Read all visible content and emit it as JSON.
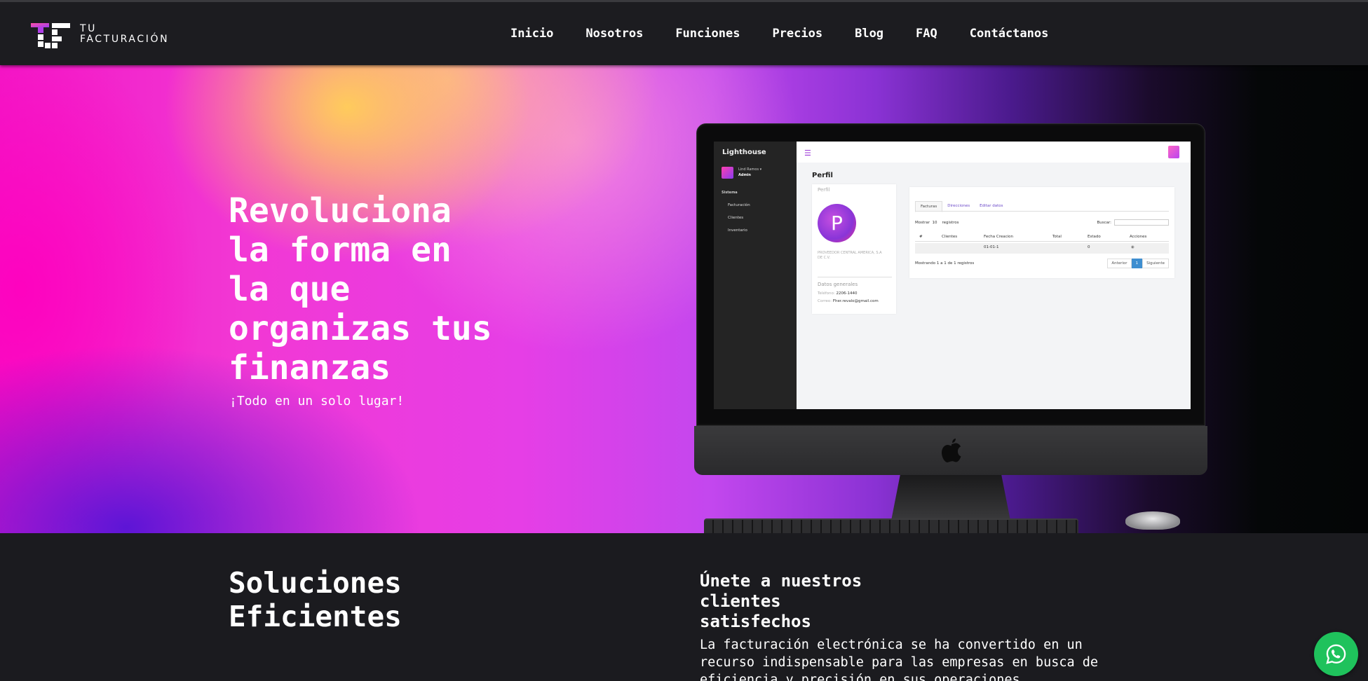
{
  "brand": {
    "line1": "TU",
    "line2": "FACTURACIÓN"
  },
  "nav": [
    "Inicio",
    "Nosotros",
    "Funciones",
    "Precios",
    "Blog",
    "FAQ",
    "Contáctanos"
  ],
  "hero": {
    "title_lines": [
      "Revoluciona",
      "la forma en",
      "la que",
      "organizas tus",
      "finanzas"
    ],
    "subtitle": "¡Todo en un solo lugar!"
  },
  "app_preview": {
    "brand": "Lighthouse",
    "user_name": "Lind Ramos ▾",
    "user_role": "Admin",
    "section": "Sistema",
    "menu": [
      "Facturación",
      "Clientes",
      "Inventario"
    ],
    "page_title": "Perfil",
    "card_title": "Perfil",
    "avatar_letter": "P",
    "company": "PROVEEDOR CENTRAL AMERICA, S.A DE C.V.",
    "general_title": "Datos generales",
    "phone_label": "Teléfono:",
    "phone_value": "2206-1440",
    "email_label": "Correo:",
    "email_value": "Fher.revalo@gmail.com",
    "tabs": [
      "Facturas",
      "Direcciones",
      "Editar datos"
    ],
    "show_label": "Mostrar",
    "show_value": "10",
    "records_label": "registros",
    "search_label": "Buscar:",
    "columns": [
      "#",
      "Clientes",
      "Fecha Creacion",
      "Total",
      "Estado",
      "Acciones"
    ],
    "row": {
      "date": "01-01-1",
      "status": "0"
    },
    "footer": "Mostrando 1 a 1 de 1 registros",
    "prev": "Anterior",
    "page": "1",
    "next": "Siguiente"
  },
  "solutions": {
    "title_lines": [
      "Soluciones",
      "Eficientes"
    ]
  },
  "join": {
    "title_lines": [
      "Únete a nuestros",
      "clientes",
      "satisfechos"
    ],
    "body": "La facturación electrónica se ha convertido en un recurso indispensable para las empresas en busca de eficiencia y precisión en sus operaciones financieras."
  },
  "colors": {
    "whatsapp": "#1fc25c",
    "navbar": "#1c1c20",
    "page_bg": "#1b1b1f"
  }
}
